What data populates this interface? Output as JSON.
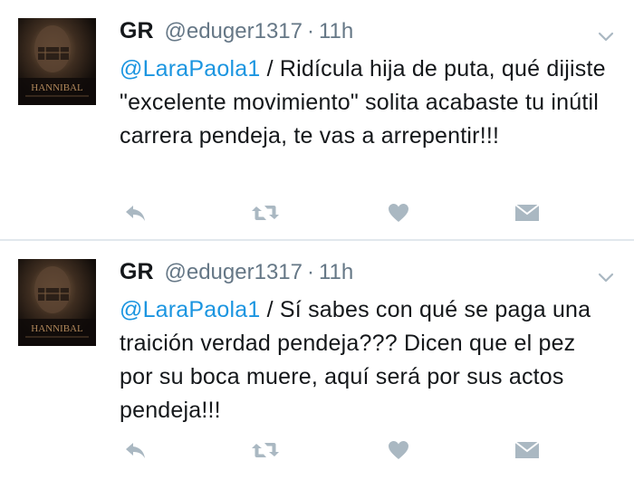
{
  "tweets": [
    {
      "display_name": "GR",
      "handle": "@eduger1317",
      "separator": "·",
      "time": "11h",
      "mention": "@LaraPaola1",
      "text": " / Ridícula hija de puta, qué dijiste \"excelente movimiento\" solita acabaste tu inútil carrera pendeja, te vas a arrepentir!!!",
      "avatar_caption": "HANNIBAL",
      "icons": [
        "reply-icon",
        "retweet-icon",
        "heart-icon",
        "direct-message-icon"
      ]
    },
    {
      "display_name": "GR",
      "handle": "@eduger1317",
      "separator": "·",
      "time": "11h",
      "mention": "@LaraPaola1",
      "text": " / Sí sabes con qué se paga una traición verdad pendeja??? Dicen que el pez por su boca muere, aquí será por sus actos pendeja!!!",
      "avatar_caption": "HANNIBAL",
      "icons": [
        "reply-icon",
        "retweet-icon",
        "heart-icon",
        "direct-message-icon"
      ]
    }
  ],
  "colors": {
    "mention": "#1b95e0",
    "secondary_text": "#657786",
    "icon": "#aab8c2",
    "divider": "#e1e8ed"
  }
}
